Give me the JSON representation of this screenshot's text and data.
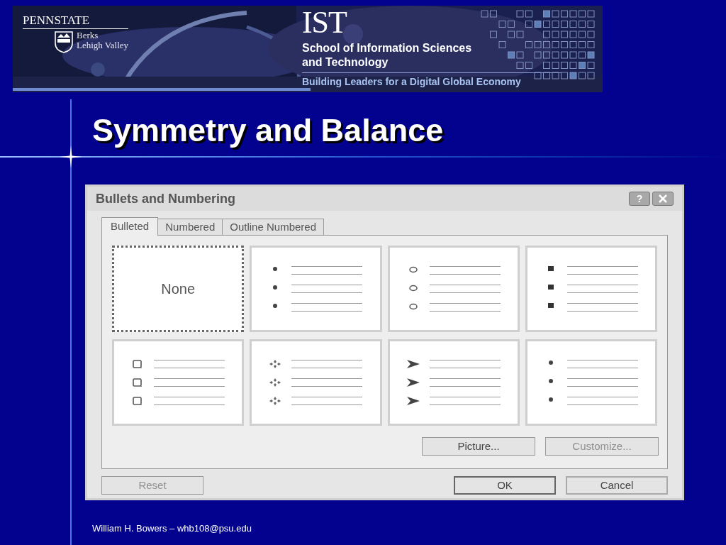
{
  "banner": {
    "logo": "PENNSTATE",
    "campus_lines": [
      "Berks",
      "Lehigh Valley"
    ],
    "ist": "IST",
    "school_lines": [
      "School of Information Sciences",
      "and Technology"
    ],
    "tagline": "Building Leaders for a Digital Global Economy"
  },
  "slide_title": "Symmetry and Balance",
  "dialog": {
    "title": "Bullets and Numbering",
    "help_button": "?",
    "tabs": [
      {
        "label": "Bulleted",
        "selected": true
      },
      {
        "label": "Numbered",
        "selected": false
      },
      {
        "label": "Outline Numbered",
        "selected": false
      }
    ],
    "bullet_styles": [
      {
        "kind": "none",
        "label": "None",
        "selected": true
      },
      {
        "kind": "dot",
        "selected": false
      },
      {
        "kind": "circle",
        "selected": false
      },
      {
        "kind": "square",
        "selected": false
      },
      {
        "kind": "box",
        "selected": false
      },
      {
        "kind": "diamond",
        "selected": false
      },
      {
        "kind": "arrow",
        "selected": false
      },
      {
        "kind": "dot",
        "selected": false
      }
    ],
    "panel_buttons": [
      {
        "label": "Picture...",
        "disabled": false
      },
      {
        "label": "Customize...",
        "disabled": true
      }
    ],
    "reset_button": {
      "label": "Reset",
      "disabled": true
    },
    "buttons": [
      {
        "label": "OK",
        "disabled": false
      },
      {
        "label": "Cancel",
        "disabled": false
      }
    ]
  },
  "footer": "William H. Bowers – whb108@psu.edu"
}
